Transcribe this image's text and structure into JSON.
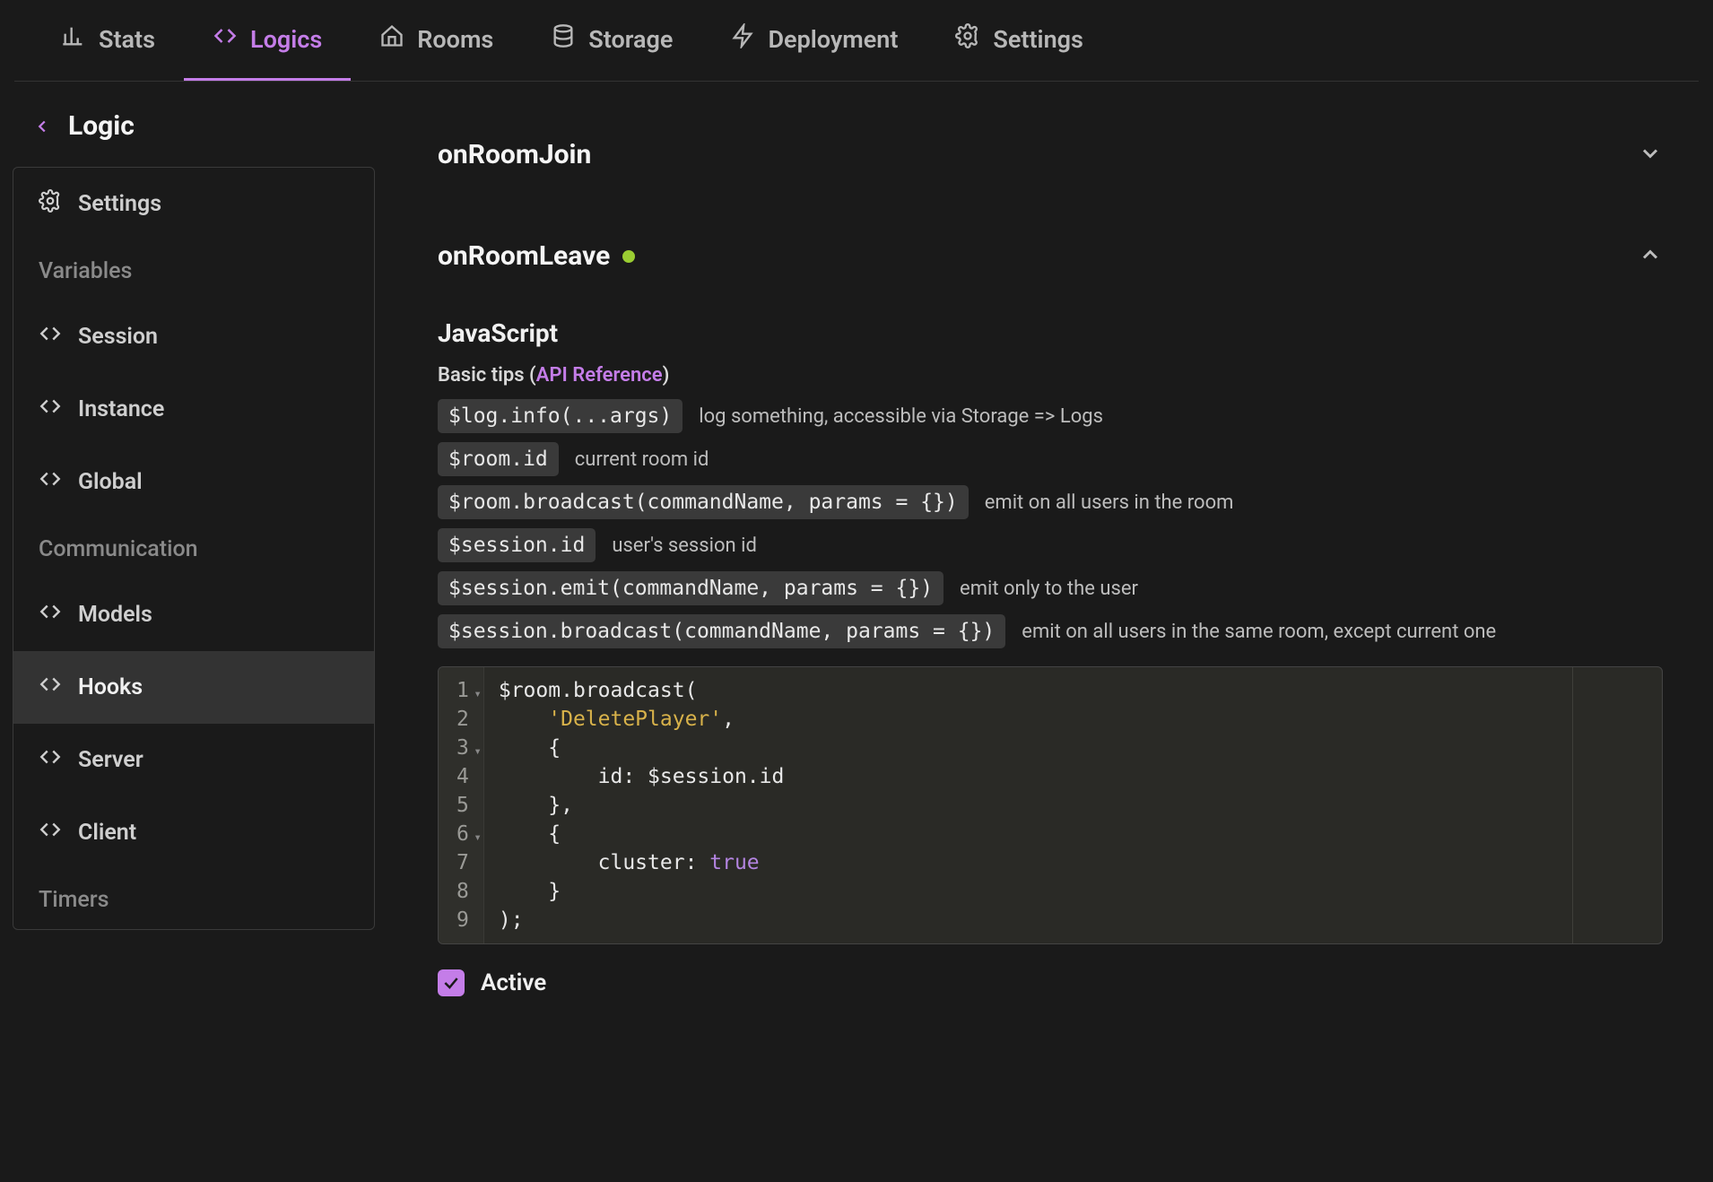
{
  "tabs": [
    {
      "label": "Stats",
      "icon": "bar-chart",
      "active": false
    },
    {
      "label": "Logics",
      "icon": "code",
      "active": true
    },
    {
      "label": "Rooms",
      "icon": "home",
      "active": false
    },
    {
      "label": "Storage",
      "icon": "database",
      "active": false
    },
    {
      "label": "Deployment",
      "icon": "bolt",
      "active": false
    },
    {
      "label": "Settings",
      "icon": "gear",
      "active": false
    }
  ],
  "breadcrumb": {
    "title": "Logic"
  },
  "sidebar": {
    "settings_label": "Settings",
    "section_variables": "Variables",
    "item_session": "Session",
    "item_instance": "Instance",
    "item_global": "Global",
    "section_communication": "Communication",
    "item_models": "Models",
    "item_hooks": "Hooks",
    "item_server": "Server",
    "item_client": "Client",
    "section_timers": "Timers"
  },
  "hooks": {
    "collapsed": {
      "title": "onRoomJoin"
    },
    "expanded": {
      "title": "onRoomLeave",
      "active_indicator": true,
      "language_label": "JavaScript",
      "tips_prefix": "Basic tips (",
      "tips_link": "API Reference",
      "tips_suffix": ")",
      "tips": [
        {
          "code": "$log.info(...args)",
          "desc": "log something, accessible via Storage => Logs"
        },
        {
          "code": "$room.id",
          "desc": "current room id"
        },
        {
          "code": "$room.broadcast(commandName, params = {})",
          "desc": "emit on all users in the room"
        },
        {
          "code": "$session.id",
          "desc": "user's session id"
        },
        {
          "code": "$session.emit(commandName, params = {})",
          "desc": "emit only to the user"
        },
        {
          "code": "$session.broadcast(commandName, params = {})",
          "desc": "emit on all users in the same room, except current one"
        }
      ],
      "code_lines": [
        {
          "n": 1,
          "fold": true,
          "segs": [
            {
              "t": "$room.broadcast("
            }
          ]
        },
        {
          "n": 2,
          "segs": [
            {
              "t": "    "
            },
            {
              "t": "'DeletePlayer'",
              "c": "tok-str"
            },
            {
              "t": ","
            }
          ]
        },
        {
          "n": 3,
          "fold": true,
          "segs": [
            {
              "t": "    {"
            }
          ]
        },
        {
          "n": 4,
          "segs": [
            {
              "t": "        id: $session.id"
            }
          ]
        },
        {
          "n": 5,
          "segs": [
            {
              "t": "    },"
            }
          ]
        },
        {
          "n": 6,
          "fold": true,
          "segs": [
            {
              "t": "    {"
            }
          ]
        },
        {
          "n": 7,
          "segs": [
            {
              "t": "        cluster: "
            },
            {
              "t": "true",
              "c": "tok-kw"
            }
          ]
        },
        {
          "n": 8,
          "segs": [
            {
              "t": "    }"
            }
          ]
        },
        {
          "n": 9,
          "segs": [
            {
              "t": ");"
            }
          ]
        }
      ],
      "active_checkbox_label": "Active",
      "active_checked": true
    }
  }
}
